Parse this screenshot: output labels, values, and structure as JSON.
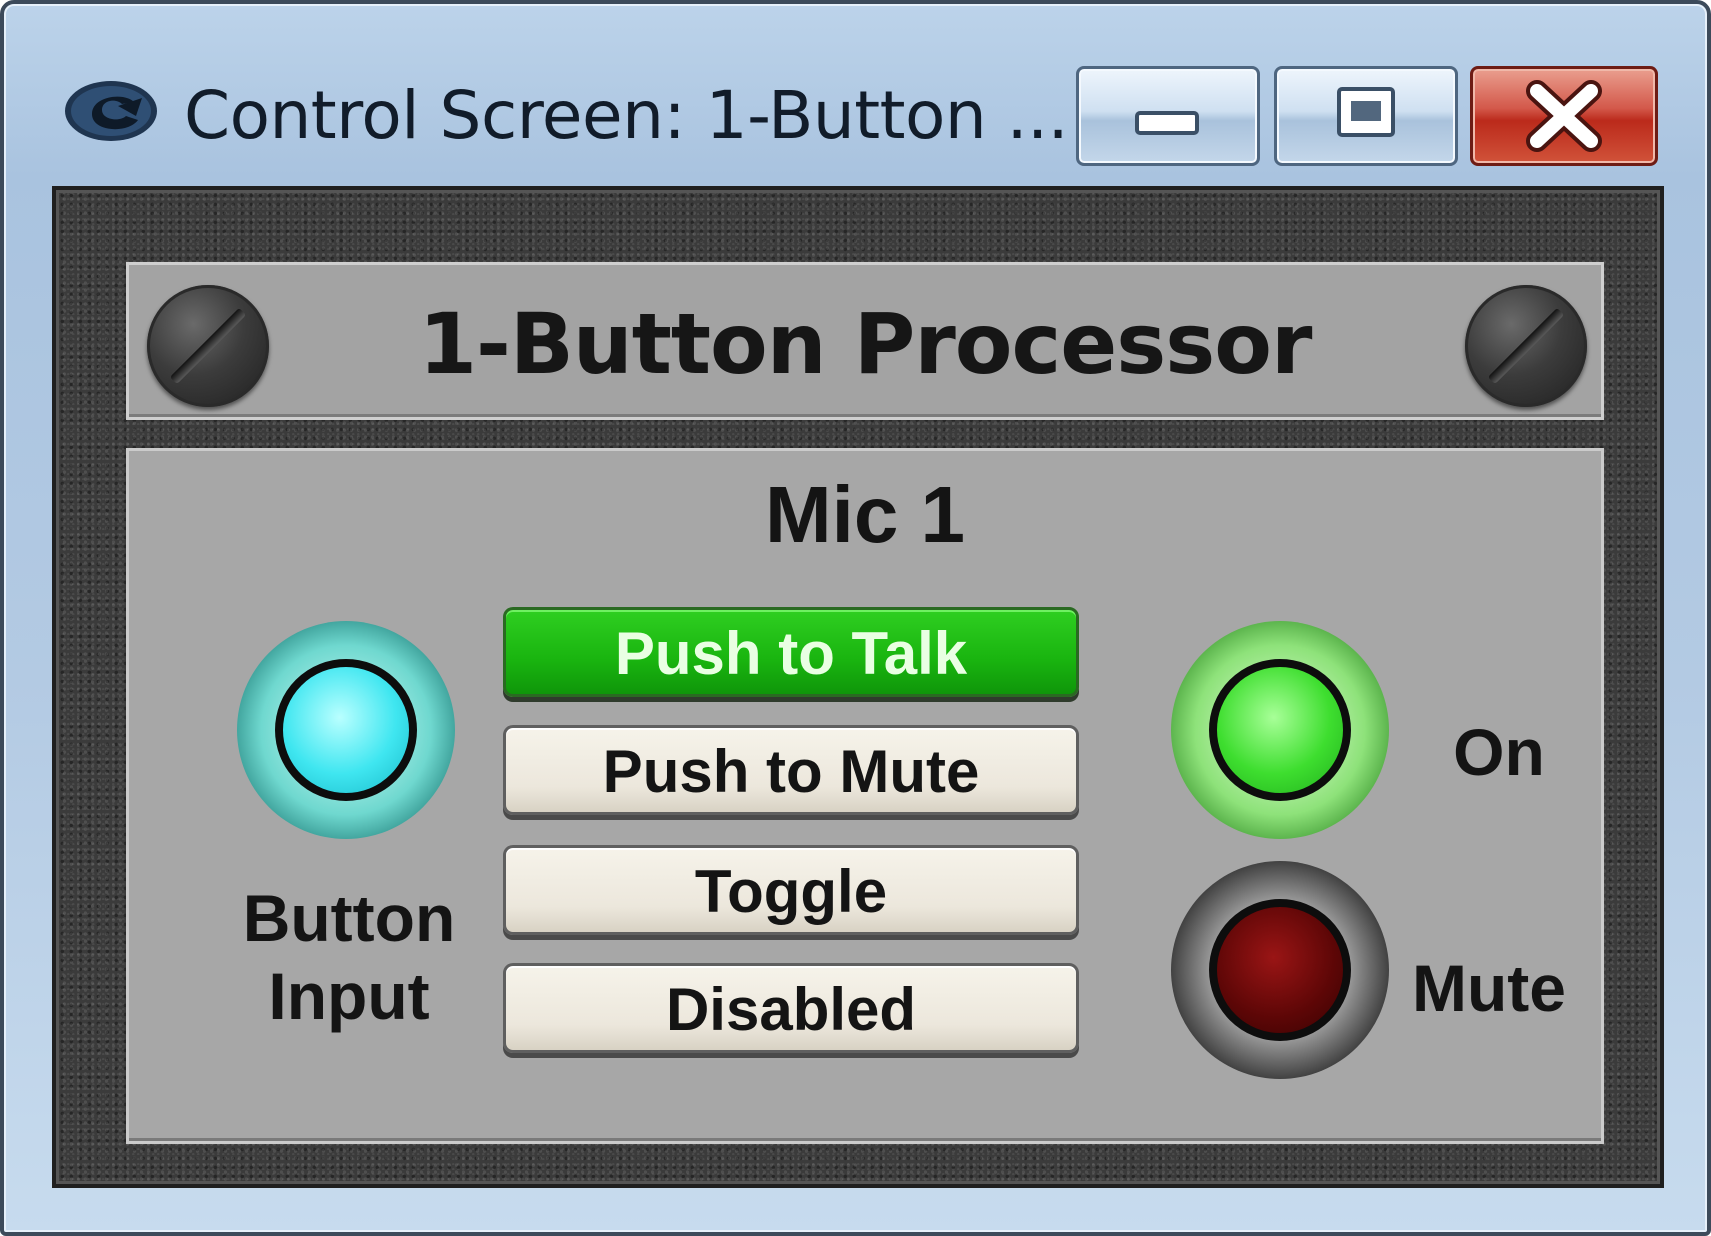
{
  "window": {
    "title": "Control Screen: 1-Button ...",
    "controls": {
      "minimize_icon": "minimize-icon",
      "maximize_icon": "maximize-icon",
      "close_icon": "close-icon"
    }
  },
  "device": {
    "title": "1-Button Processor",
    "channel": "Mic 1",
    "indicators": {
      "button_input": {
        "label_line1": "Button",
        "label_line2": "Input",
        "color": "#3fe6f0",
        "lit": true
      },
      "on": {
        "label": "On",
        "color": "#3ede2f",
        "lit": true
      },
      "mute": {
        "label": "Mute",
        "color": "#5c0606",
        "lit": false
      }
    },
    "modes": [
      {
        "label": "Push to Talk",
        "selected": true
      },
      {
        "label": "Push to Mute",
        "selected": false
      },
      {
        "label": "Toggle",
        "selected": false
      },
      {
        "label": "Disabled",
        "selected": false
      }
    ],
    "colors": {
      "active_mode": "#19b40f",
      "panel": "#a7a7a7",
      "frame": "#3b3b3b"
    }
  }
}
